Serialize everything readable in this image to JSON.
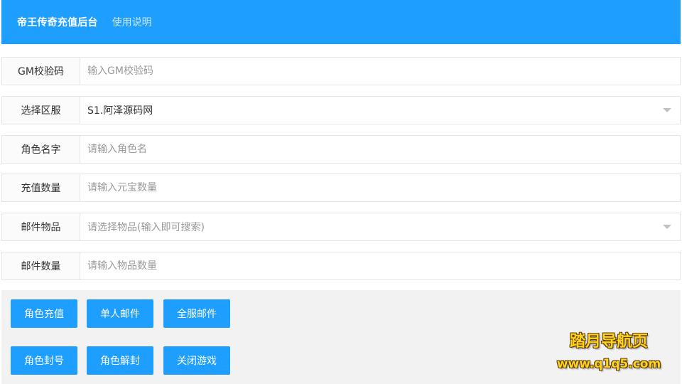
{
  "header": {
    "title": "帝王传奇充值后台",
    "help_link": "使用说明"
  },
  "form": {
    "gm_code": {
      "label": "GM校验码",
      "placeholder": "输入GM校验码",
      "value": ""
    },
    "server": {
      "label": "选择区服",
      "value": "S1.阿泽源码网"
    },
    "role_name": {
      "label": "角色名字",
      "placeholder": "请输入角色名",
      "value": ""
    },
    "recharge_amount": {
      "label": "充值数量",
      "placeholder": "请输入元宝数量",
      "value": ""
    },
    "mail_item": {
      "label": "邮件物品",
      "placeholder": "请选择物品(输入即可搜索)"
    },
    "mail_quantity": {
      "label": "邮件数量",
      "placeholder": "请输入物品数量",
      "value": ""
    }
  },
  "actions": {
    "recharge": "角色充值",
    "single_mail": "单人邮件",
    "server_mail": "全服邮件",
    "ban_role": "角色封号",
    "unban_role": "角色解封",
    "close_game": "关闭游戏"
  },
  "watermark": {
    "title": "踏月导航页",
    "url": "www.q1q5.com"
  },
  "colors": {
    "primary": "#1e9fff",
    "panel_bg": "#f2f2f2",
    "border": "#e6e6e6",
    "watermark_yellow": "#ffd21f"
  }
}
